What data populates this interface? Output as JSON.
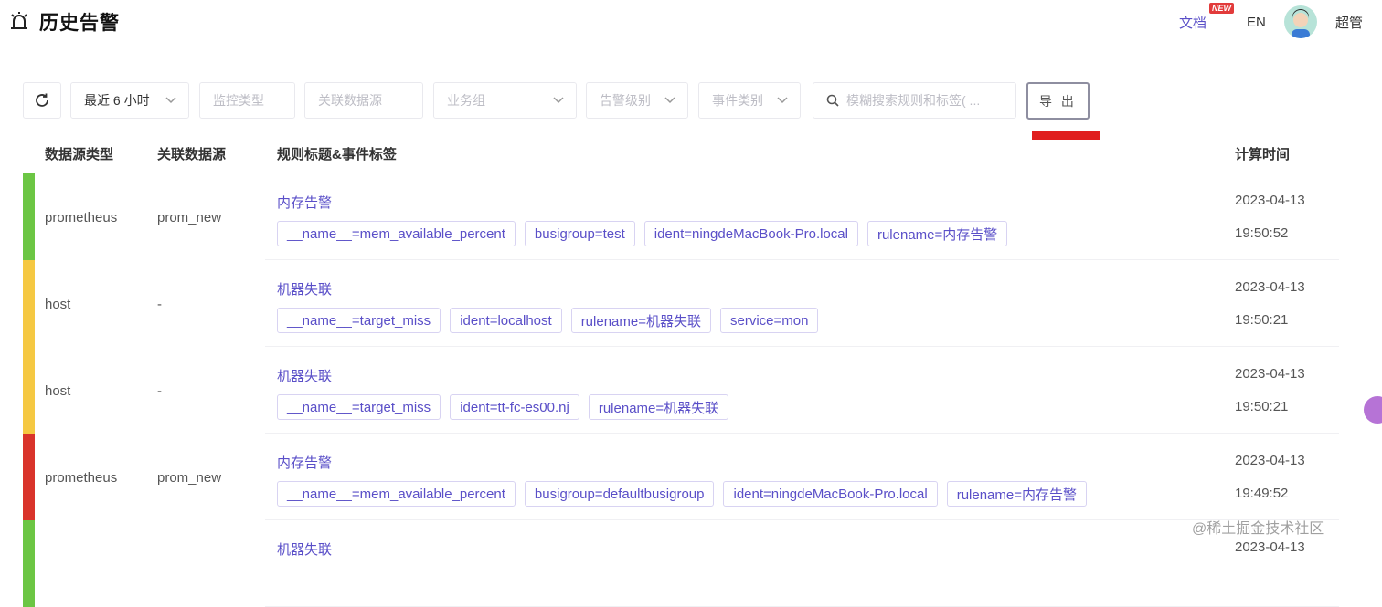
{
  "header": {
    "title": "历史告警",
    "doc_link": "文档",
    "new_badge": "NEW",
    "lang": "EN",
    "user": "超管"
  },
  "toolbar": {
    "time_range": "最近 6 小时",
    "monitor_type_placeholder": "监控类型",
    "datasource_placeholder": "关联数据源",
    "busigroup_placeholder": "业务组",
    "severity_placeholder": "告警级别",
    "event_type_placeholder": "事件类别",
    "search_placeholder": "模糊搜索规则和标签( ...",
    "export_label": "导 出"
  },
  "table": {
    "columns": [
      "数据源类型",
      "关联数据源",
      "规则标题&事件标签",
      "计算时间"
    ],
    "rows": [
      {
        "severity_color": "#6cc644",
        "datasource_type": "prometheus",
        "datasource": "prom_new",
        "title": "内存告警",
        "tags": [
          "__name__=mem_available_percent",
          "busigroup=test",
          "ident=ningdeMacBook-Pro.local",
          "rulename=内存告警"
        ],
        "date": "2023-04-13",
        "time": "19:50:52"
      },
      {
        "severity_color": "#f5c842",
        "datasource_type": "host",
        "datasource": "-",
        "title": "机器失联",
        "tags": [
          "__name__=target_miss",
          "ident=localhost",
          "rulename=机器失联",
          "service=mon"
        ],
        "date": "2023-04-13",
        "time": "19:50:21"
      },
      {
        "severity_color": "#f5c842",
        "datasource_type": "host",
        "datasource": "-",
        "title": "机器失联",
        "tags": [
          "__name__=target_miss",
          "ident=tt-fc-es00.nj",
          "rulename=机器失联"
        ],
        "date": "2023-04-13",
        "time": "19:50:21"
      },
      {
        "severity_color": "#d9342b",
        "datasource_type": "prometheus",
        "datasource": "prom_new",
        "title": "内存告警",
        "tags": [
          "__name__=mem_available_percent",
          "busigroup=defaultbusigroup",
          "ident=ningdeMacBook-Pro.local",
          "rulename=内存告警"
        ],
        "date": "2023-04-13",
        "time": "19:49:52"
      },
      {
        "severity_color": "#6cc644",
        "datasource_type": "",
        "datasource": "",
        "title": "机器失联",
        "tags": [],
        "date": "2023-04-13",
        "time": ""
      }
    ]
  },
  "watermark": "@稀土掘金技术社区"
}
